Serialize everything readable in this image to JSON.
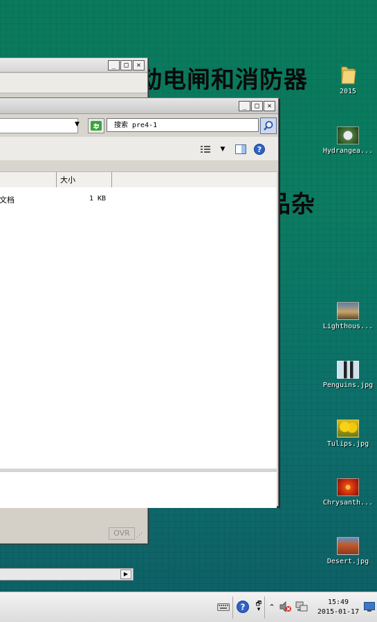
{
  "wallpaper": {
    "line1": "动电闸和消防器",
    "line2": "品杂"
  },
  "explorer": {
    "search_placeholder": "搜索 pre4-1",
    "columns": {
      "size": "大小"
    },
    "rows": [
      {
        "type_fragment": "文档",
        "size": "1 KB"
      }
    ]
  },
  "back_window": {
    "status_ovr": "OVR"
  },
  "desktop_icons": [
    {
      "label": "2015",
      "icon": "folder-icon"
    },
    {
      "label": "Hydrangea...",
      "icon": "image-thumb"
    },
    {
      "label": "Lighthous...",
      "icon": "image-thumb"
    },
    {
      "label": "Penguins.jpg",
      "icon": "image-thumb"
    },
    {
      "label": "Tulips.jpg",
      "icon": "image-thumb"
    },
    {
      "label": "Chrysanth...",
      "icon": "image-thumb"
    },
    {
      "label": "Desert.jpg",
      "icon": "image-thumb"
    }
  ],
  "taskbar": {
    "time": "15:49",
    "date": "2015-01-17"
  },
  "colors": {
    "wallpaper": "#0b7b62",
    "window_bg": "#d4d0c8",
    "search_button": "#cfd9ec"
  }
}
